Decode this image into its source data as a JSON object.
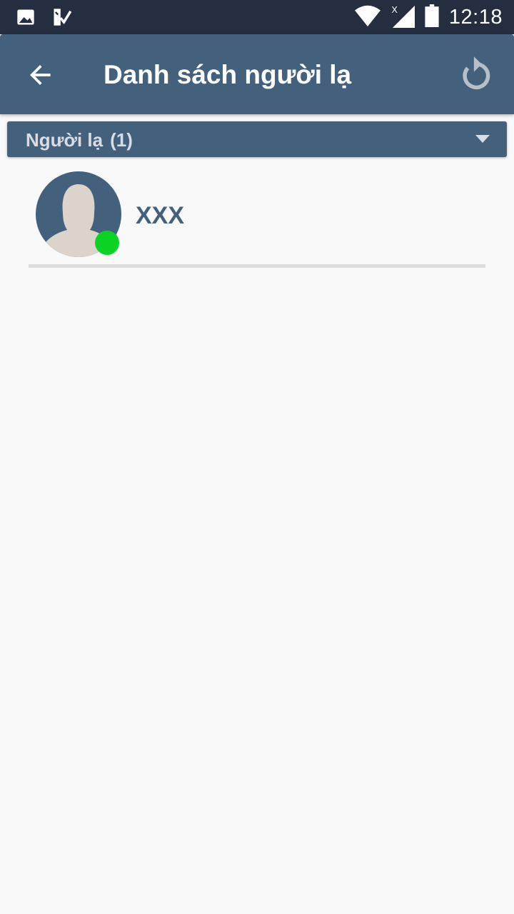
{
  "status_bar": {
    "time": "12:18",
    "icons": [
      "image-icon",
      "checklist-icon",
      "wifi-icon",
      "signal-icon",
      "battery-icon"
    ]
  },
  "app_bar": {
    "title": "Danh sách người lạ",
    "back_icon": "arrow-left-icon",
    "refresh_icon": "refresh-icon"
  },
  "group": {
    "label": "Người lạ",
    "count": "(1)",
    "expand_icon": "caret-down-icon"
  },
  "contacts": [
    {
      "name": "XXX",
      "status": "online"
    }
  ],
  "colors": {
    "primary": "#43607d",
    "status_bar": "#252d40",
    "online": "#0ad324",
    "background": "#f9f9f9",
    "avatar_silhouette": "#dcd3ca"
  }
}
